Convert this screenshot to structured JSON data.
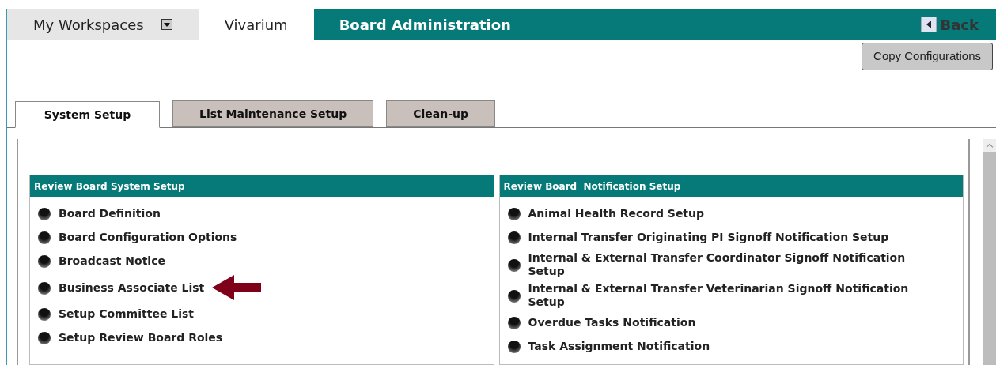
{
  "top_tabs": [
    {
      "label": "My Workspaces",
      "selected": false,
      "dropdown": true
    },
    {
      "label": "Vivarium",
      "selected": true,
      "dropdown": false
    }
  ],
  "module_title": "Board Administration",
  "back": "Back",
  "copy_button": "Copy Configurations",
  "tabs": [
    {
      "label": "System Setup",
      "selected": true
    },
    {
      "label": "List Maintenance Setup",
      "selected": false
    },
    {
      "label": "Clean-up",
      "selected": false
    }
  ],
  "sections": [
    {
      "title": "Review Board System Setup",
      "items": [
        "Board Definition",
        "Board Configuration Options",
        "Broadcast Notice",
        "Business Associate List",
        "Setup Committee List",
        "Setup Review Board Roles"
      ]
    },
    {
      "title": "Review Board  Notification Setup",
      "items": [
        "Animal Health Record Setup",
        "Internal Transfer Originating PI Signoff Notification Setup",
        "Internal & External Transfer Coordinator Signoff Notification Setup",
        "Internal & External Transfer Veterinarian Signoff Notification Setup",
        "Overdue Tasks Notification",
        "Task Assignment Notification"
      ]
    }
  ]
}
